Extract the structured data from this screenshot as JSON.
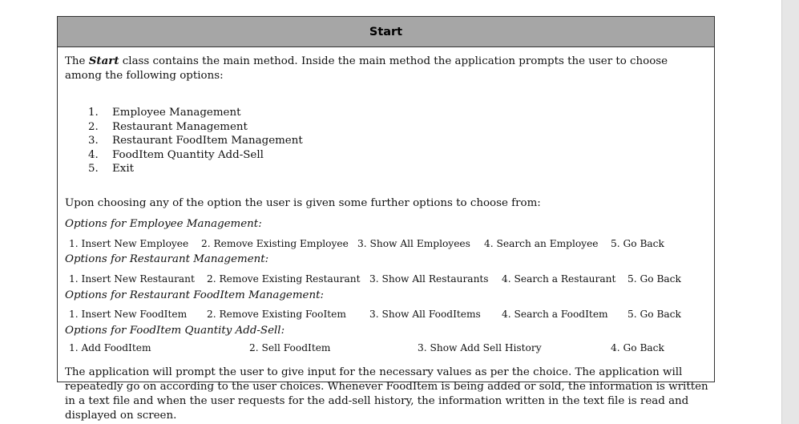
{
  "header": {
    "title": "Start"
  },
  "intro": {
    "prefix": "The ",
    "class_name": "Start",
    "suffix": " class contains the main method. Inside the main method the application prompts the user to choose among the following options:"
  },
  "main_options": [
    {
      "num": "1.",
      "label": "Employee Management"
    },
    {
      "num": "2.",
      "label": "Restaurant Management"
    },
    {
      "num": "3.",
      "label": "Restaurant FoodItem Management"
    },
    {
      "num": "4.",
      "label": "FoodItem Quantity Add-Sell"
    },
    {
      "num": "5.",
      "label": "Exit"
    }
  ],
  "further_text": "Upon choosing any of the option the user is given some further options to choose from:",
  "sections": [
    {
      "title": "Options for Employee Management:",
      "items": [
        "1.   Insert New Employee",
        "2.   Remove Existing Employee",
        "3.   Show All Employees",
        "4.   Search an Employee",
        "5.   Go Back"
      ]
    },
    {
      "title": "Options for Restaurant Management:",
      "items": [
        "1.   Insert New Restaurant",
        "2.   Remove Existing Restaurant",
        "3.   Show All Restaurants",
        "4.   Search a Restaurant",
        "5.   Go Back"
      ]
    },
    {
      "title": "Options for Restaurant FoodItem Management:",
      "items": [
        "1.   Insert New FoodItem",
        "2.   Remove Existing FooItem",
        "3.   Show All FoodItems",
        "4.   Search a FoodItem",
        "5.   Go Back"
      ]
    },
    {
      "title": "Options for FoodItem Quantity Add-Sell:",
      "items": [
        "1.   Add FoodItem",
        "2.   Sell FoodItem",
        "3.   Show Add Sell History",
        "4.   Go Back"
      ]
    }
  ],
  "closing_text": "The application will prompt the user to give input for the necessary values as per the choice. The application will repeatedly go on according to the user choices. Whenever FoodItem is being added or sold, the information is written in a text file and when the user requests for the add-sell history, the information written in the text file is read and displayed on screen."
}
